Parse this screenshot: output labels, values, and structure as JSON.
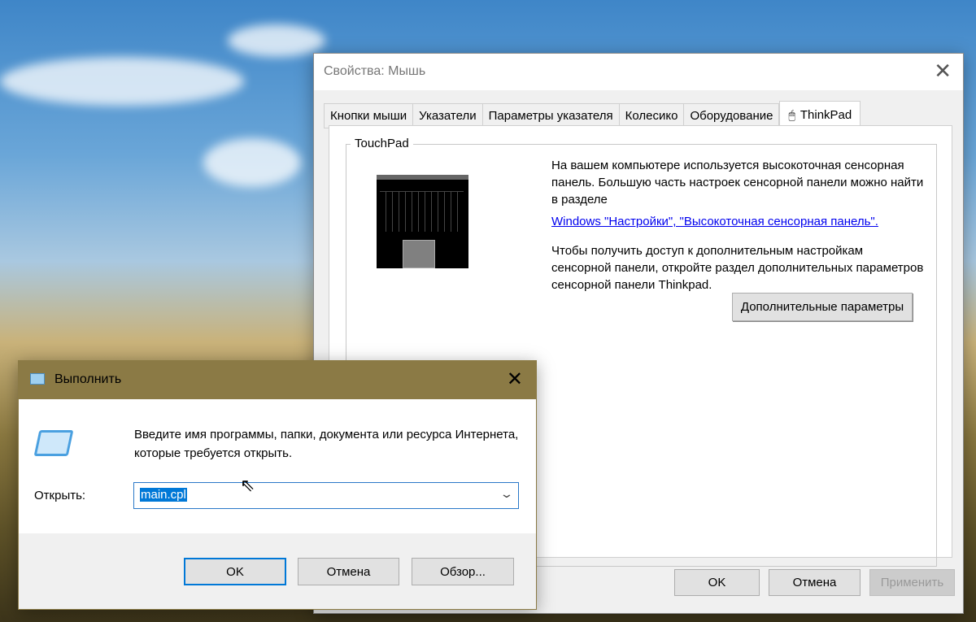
{
  "mouse_props": {
    "title": "Свойства: Мышь",
    "tabs": [
      {
        "label": "Кнопки мыши"
      },
      {
        "label": "Указатели"
      },
      {
        "label": "Параметры указателя"
      },
      {
        "label": "Колесико"
      },
      {
        "label": "Оборудование"
      },
      {
        "label": "ThinkPad",
        "active": true
      }
    ],
    "group_title": "TouchPad",
    "paragraph1": "На вашем компьютере используется высокоточная сенсорная панель. Большую часть настроек сенсорной панели можно найти в разделе",
    "link": "Windows \"Настройки\", \"Высокоточная сенсорная панель\".",
    "paragraph2": "Чтобы получить доступ к дополнительным настройкам сенсорной панели, откройте раздел дополнительных параметров сенсорной панели Thinkpad.",
    "advanced_button": "Дополнительные параметры",
    "ok": "OK",
    "cancel": "Отмена",
    "apply": "Применить"
  },
  "run_dialog": {
    "title": "Выполнить",
    "title_color": "#8b7a45",
    "description": "Введите имя программы, папки, документа или ресурса Интернета, которые требуется открыть.",
    "open_label": "Открыть:",
    "input_value": "main.cpl",
    "ok": "OK",
    "cancel": "Отмена",
    "browse": "Обзор..."
  }
}
